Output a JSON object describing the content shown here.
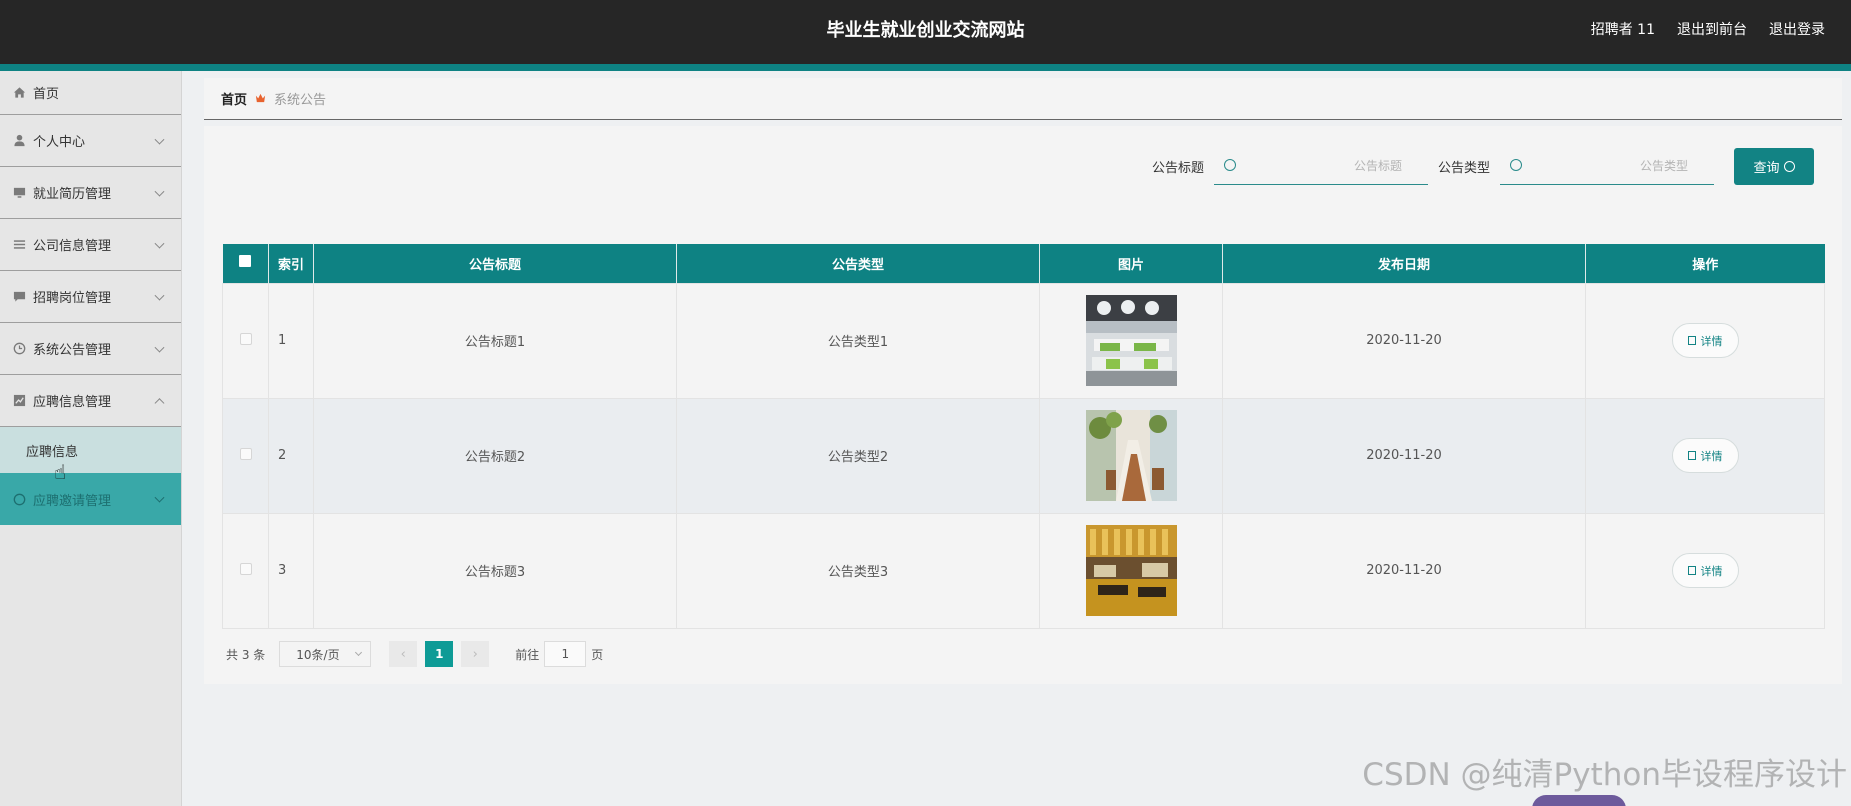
{
  "header": {
    "site_title": "毕业生就业创业交流网站",
    "user": "招聘者 11",
    "front_link": "退出到前台",
    "logout_link": "退出登录"
  },
  "colors": {
    "accent": "#0e8283",
    "header_bg": "#262626",
    "sidebar_active": "#39a8a8",
    "page_active": "#0e9b96",
    "breadcrumb_sep": "#e8632f"
  },
  "sidebar": {
    "items": [
      {
        "label": "首页",
        "icon": "home-icon"
      },
      {
        "label": "个人中心",
        "icon": "user-icon"
      },
      {
        "label": "就业简历管理",
        "icon": "monitor-icon"
      },
      {
        "label": "公司信息管理",
        "icon": "list-icon"
      },
      {
        "label": "招聘岗位管理",
        "icon": "chat-icon"
      },
      {
        "label": "系统公告管理",
        "icon": "clock-icon"
      },
      {
        "label": "应聘信息管理",
        "icon": "chart-icon",
        "expanded": true
      },
      {
        "label": "应聘邀请管理",
        "icon": "circle-icon"
      }
    ],
    "sub_item": "应聘信息"
  },
  "breadcrumb": {
    "home": "首页",
    "current": "系统公告"
  },
  "search": {
    "title_label": "公告标题",
    "title_placeholder": "公告标题",
    "type_label": "公告类型",
    "type_placeholder": "公告类型",
    "button": "查询"
  },
  "table": {
    "columns": [
      "索引",
      "公告标题",
      "公告类型",
      "图片",
      "发布日期",
      "操作"
    ],
    "rows": [
      {
        "index": "1",
        "title": "公告标题1",
        "type": "公告类型1",
        "date": "2020-11-20",
        "action": "详情"
      },
      {
        "index": "2",
        "title": "公告标题2",
        "type": "公告类型2",
        "date": "2020-11-20",
        "action": "详情"
      },
      {
        "index": "3",
        "title": "公告标题3",
        "type": "公告类型3",
        "date": "2020-11-20",
        "action": "详情"
      }
    ]
  },
  "pagination": {
    "total": "共 3 条",
    "page_size": "10条/页",
    "prev": "‹",
    "current_page": "1",
    "next": "›",
    "goto_label": "前往",
    "goto_value": "1",
    "page_suffix": "页"
  },
  "watermark": "CSDN @纯清Python毕设程序设计"
}
